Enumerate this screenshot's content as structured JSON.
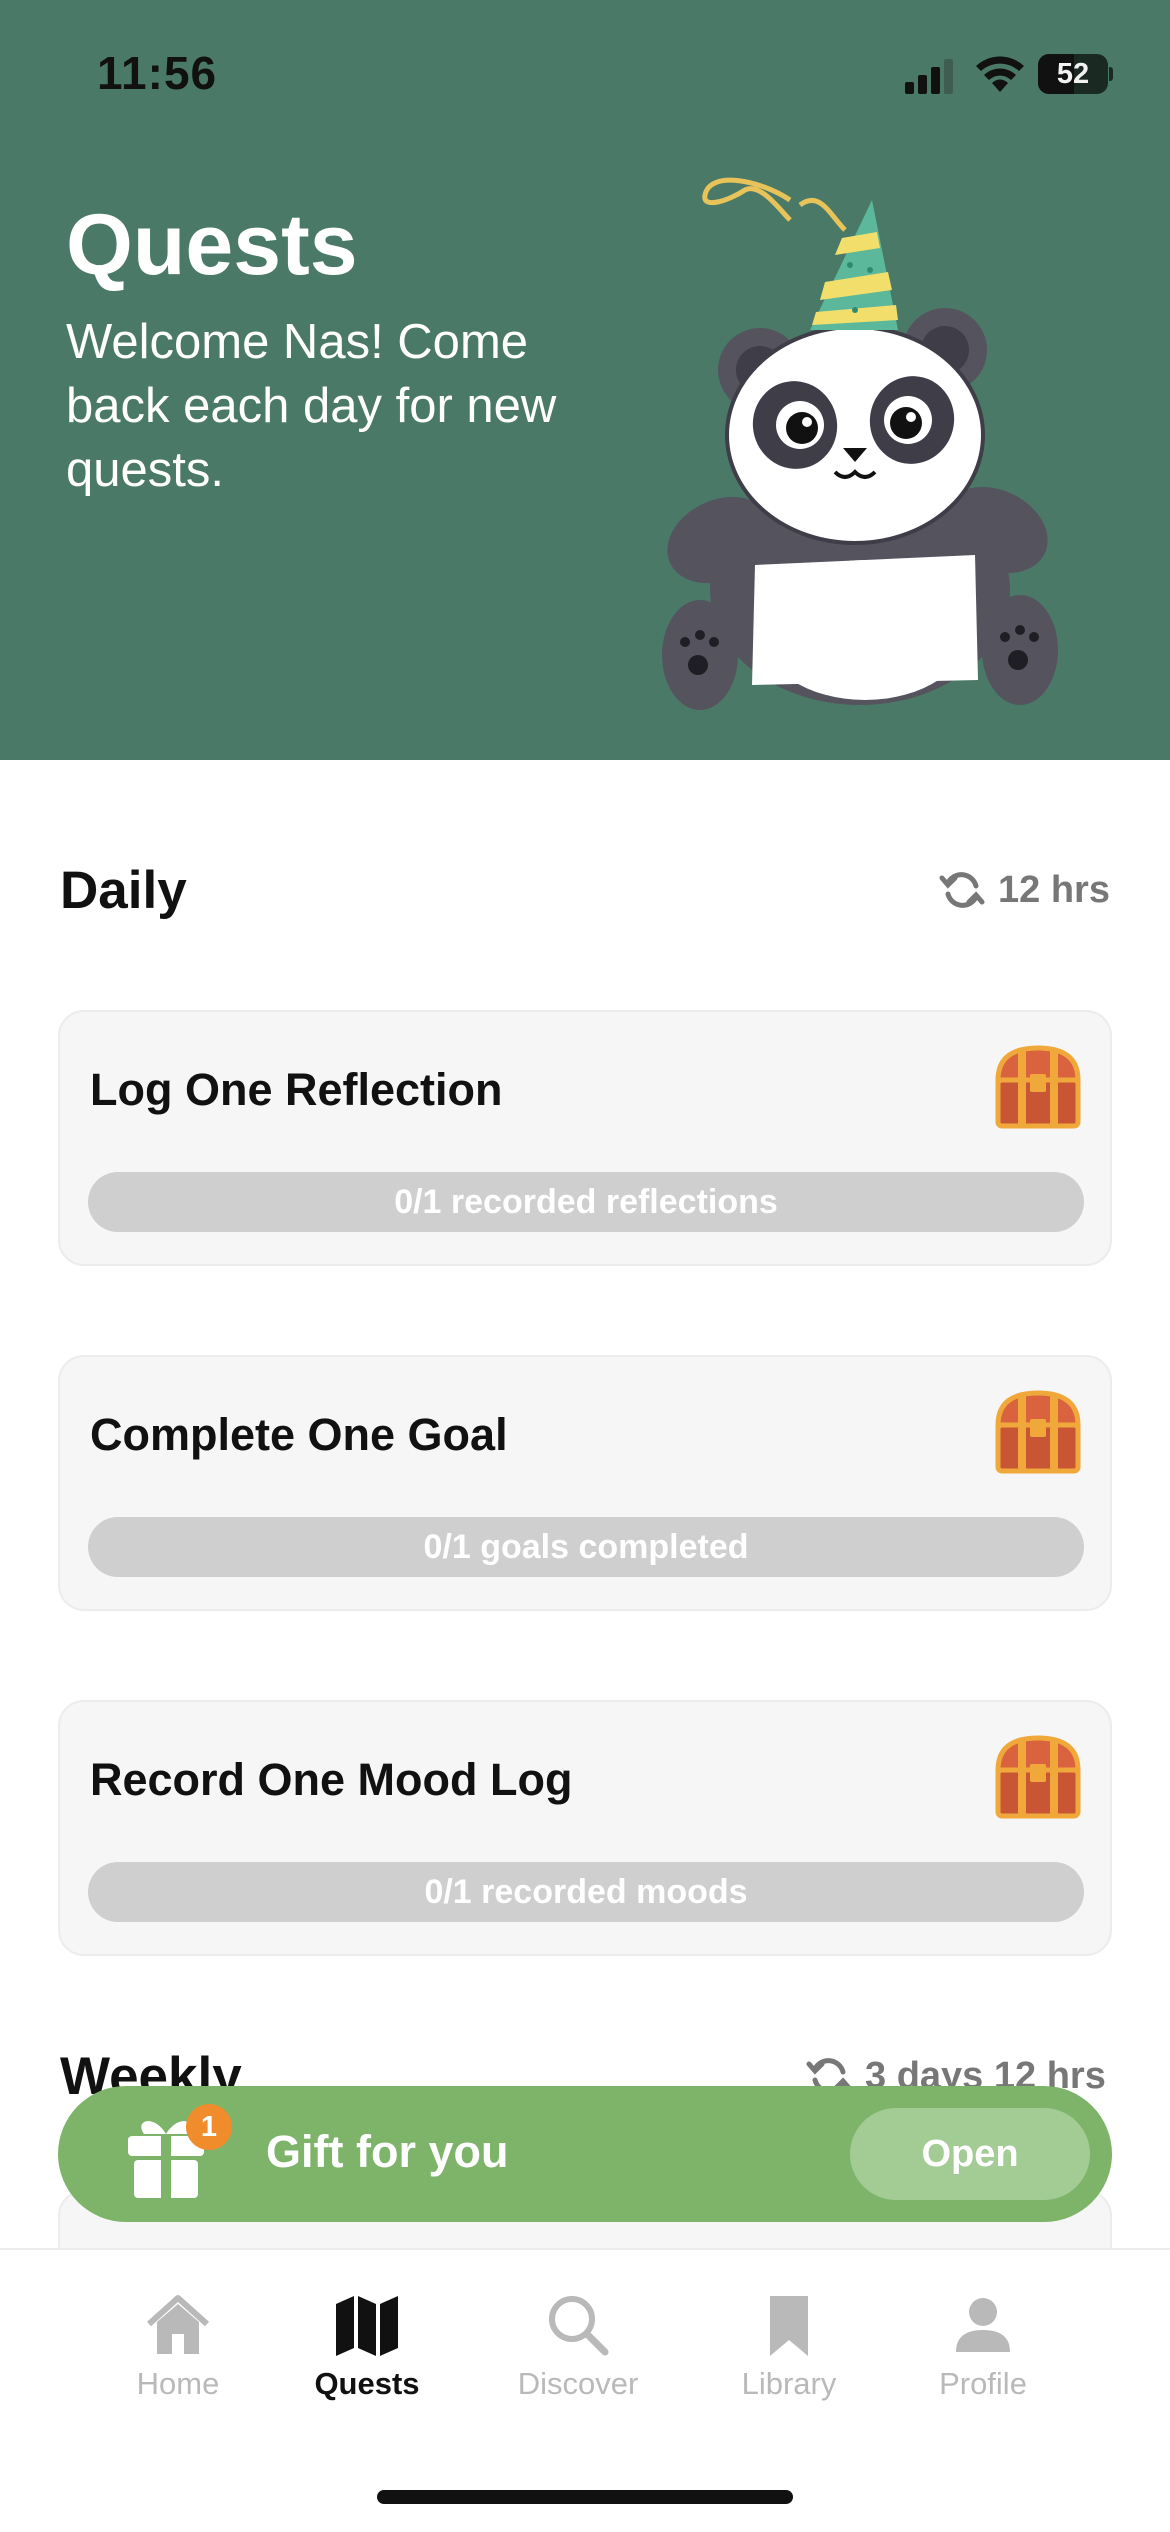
{
  "status_bar": {
    "time": "11:56",
    "battery": "52",
    "battery_level": 0.52
  },
  "header": {
    "title": "Quests",
    "subtitle": "Welcome Nas! Come back each day for new quests.",
    "background_color": "#4a7a67",
    "mascot_icon": "panda-party-hat-icon"
  },
  "daily": {
    "title": "Daily",
    "refresh_icon": "refresh-icon",
    "refresh_time": "12 hrs",
    "quests": [
      {
        "title": "Log One Reflection",
        "progress_text": "0/1 recorded reflections",
        "progress": 0,
        "reward_icon": "treasure-chest-icon"
      },
      {
        "title": "Complete One Goal",
        "progress_text": "0/1 goals completed",
        "progress": 0,
        "reward_icon": "treasure-chest-icon"
      },
      {
        "title": "Record One Mood Log",
        "progress_text": "0/1 recorded moods",
        "progress": 0,
        "reward_icon": "treasure-chest-icon"
      }
    ]
  },
  "weekly": {
    "title": "Weekly",
    "refresh_time": "3 days 12 hrs"
  },
  "gift_banner": {
    "label": "Gift for you",
    "badge_count": "1",
    "open_label": "Open",
    "color": "#7db46a"
  },
  "tabbar": {
    "tabs": [
      {
        "label": "Home",
        "icon": "home-icon",
        "active": false
      },
      {
        "label": "Quests",
        "icon": "map-icon",
        "active": true
      },
      {
        "label": "Discover",
        "icon": "search-icon",
        "active": false
      },
      {
        "label": "Library",
        "icon": "bookmark-icon",
        "active": false
      },
      {
        "label": "Profile",
        "icon": "person-icon",
        "active": false
      }
    ]
  }
}
